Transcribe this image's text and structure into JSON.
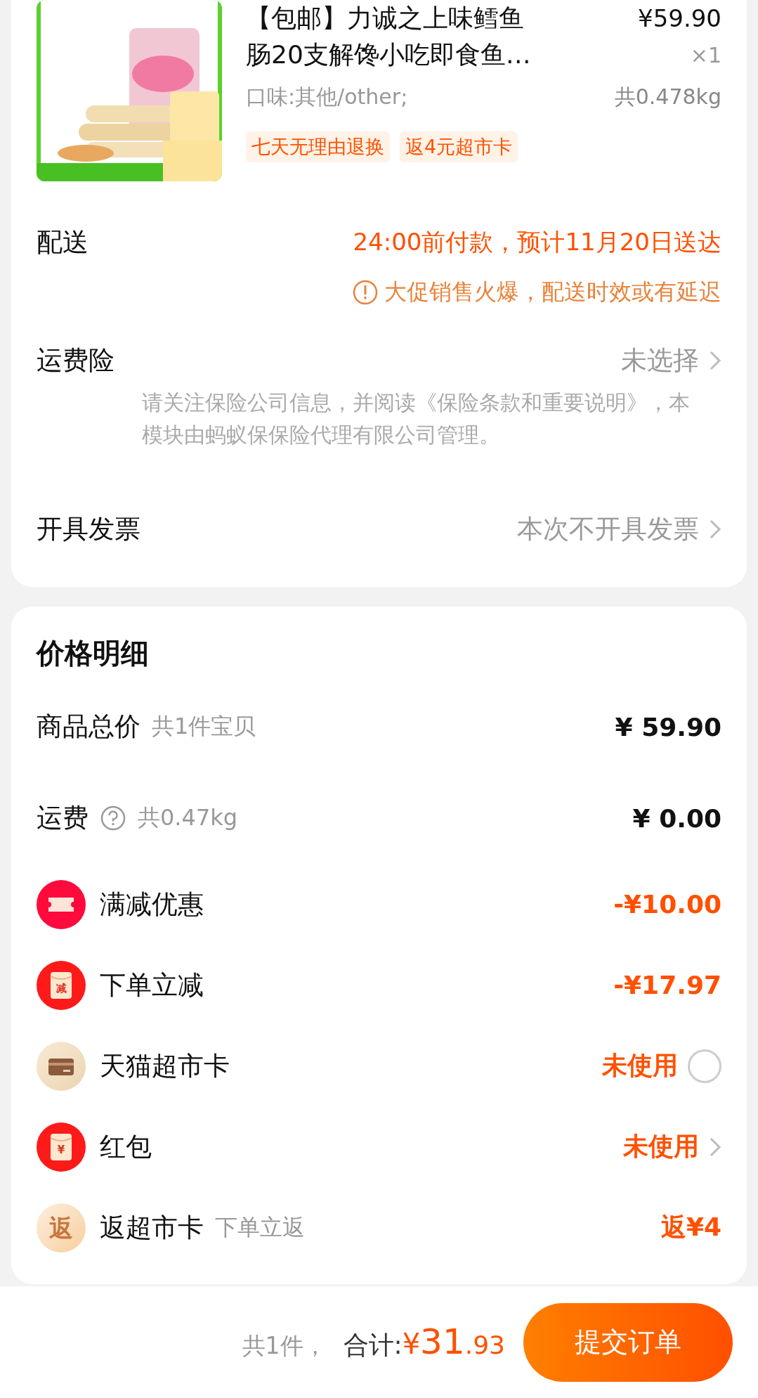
{
  "product": {
    "title_lines": [
      "【包邮】力诚之上味鳕鱼",
      "肠20支解馋小吃即食鱼…"
    ],
    "price": "¥59.90",
    "quantity": "×1",
    "spec": "口味:其他/other;",
    "weight": "共0.478kg",
    "tags": [
      "七天无理由退换",
      "返4元超市卡"
    ]
  },
  "delivery": {
    "label": "配送",
    "value": "24:00前付款，预计11月20日送达",
    "notice": "大促销售火爆，配送时效或有延迟"
  },
  "insurance": {
    "label": "运费险",
    "value": "未选择",
    "note": "请关注保险公司信息，并阅读《保险条款和重要说明》，本模块由蚂蚁保保险代理有限公司管理。"
  },
  "invoice": {
    "label": "开具发票",
    "value": "本次不开具发票"
  },
  "price_detail": {
    "title": "价格明细",
    "rows": [
      {
        "kind": "plain",
        "label": "商品总价",
        "sub": "共1件宝贝",
        "value": "¥ 59.90"
      },
      {
        "kind": "plain",
        "label": "运费",
        "help": true,
        "sub": "共0.47kg",
        "value": "¥ 0.00"
      },
      {
        "kind": "discount",
        "label": "满减优惠",
        "value": "-¥10.00"
      },
      {
        "kind": "discount",
        "badge": "减",
        "label": "下单立减",
        "value": "-¥17.97"
      },
      {
        "kind": "discount",
        "label": "天猫超市卡",
        "value": "未使用",
        "selected": false
      },
      {
        "kind": "discount",
        "badge": "¥",
        "label": "红包",
        "value": "未使用",
        "link": true
      },
      {
        "kind": "discount",
        "badge": "返",
        "label": "返超市卡",
        "sub": "下单立返",
        "value": "返¥4"
      }
    ]
  },
  "footer": {
    "count": "共1件，",
    "total_label": "合计:",
    "currency": "¥",
    "total_int": "31",
    "total_dec": ".93",
    "submit": "提交订单"
  }
}
